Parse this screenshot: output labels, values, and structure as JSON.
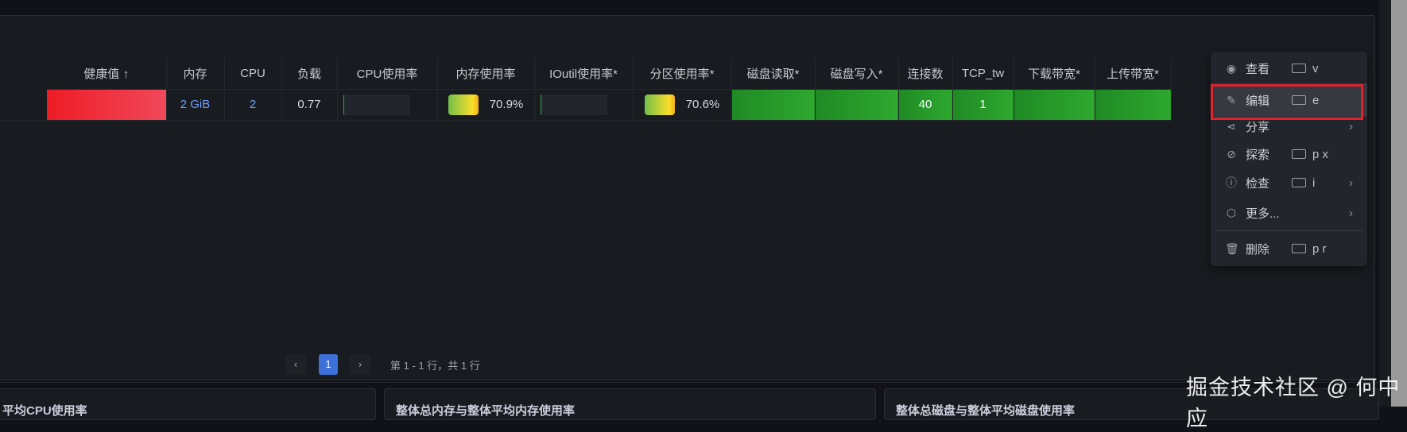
{
  "table": {
    "headers": [
      "健康值 ↑",
      "内存",
      "CPU",
      "负载",
      "CPU使用率",
      "内存使用率",
      "IOutil使用率*",
      "分区使用率*",
      "磁盘读取*",
      "磁盘写入*",
      "连接数",
      "TCP_tw",
      "下载带宽*",
      "上传带宽*"
    ],
    "row": {
      "memory": "2 GiB",
      "cpu": "2",
      "load": "0.77",
      "mem_usage": "70.9%",
      "partition_usage": "70.6%",
      "connections": "40",
      "tcp_tw": "1"
    }
  },
  "pagination": {
    "prev": "‹",
    "page": "1",
    "next": "›",
    "summary": "第 1 - 1 行，共 1 行"
  },
  "bottom_panels": [
    "平均CPU使用率",
    "整体总内存与整体平均内存使用率",
    "整体总磁盘与整体平均磁盘使用率"
  ],
  "menu": {
    "items": [
      {
        "label": "查看",
        "shortcut": "v",
        "icon": "eye-icon"
      },
      {
        "label": "编辑",
        "shortcut": "e",
        "icon": "edit-icon"
      },
      {
        "label": "分享",
        "shortcut": "",
        "icon": "share-icon"
      },
      {
        "label": "探索",
        "shortcut": "p x",
        "icon": "compass-icon"
      },
      {
        "label": "检查",
        "shortcut": "i",
        "icon": "info-icon"
      },
      {
        "label": "更多...",
        "shortcut": "",
        "icon": "cube-icon"
      },
      {
        "label": "删除",
        "shortcut": "p r",
        "icon": "trash-icon"
      }
    ]
  },
  "watermark": "掘金技术社区 @ 何中应",
  "colors": {
    "health": "#ee1c26",
    "green": "#2ea82f",
    "accent": "#3d71d9",
    "highlight": "#e0232c"
  }
}
